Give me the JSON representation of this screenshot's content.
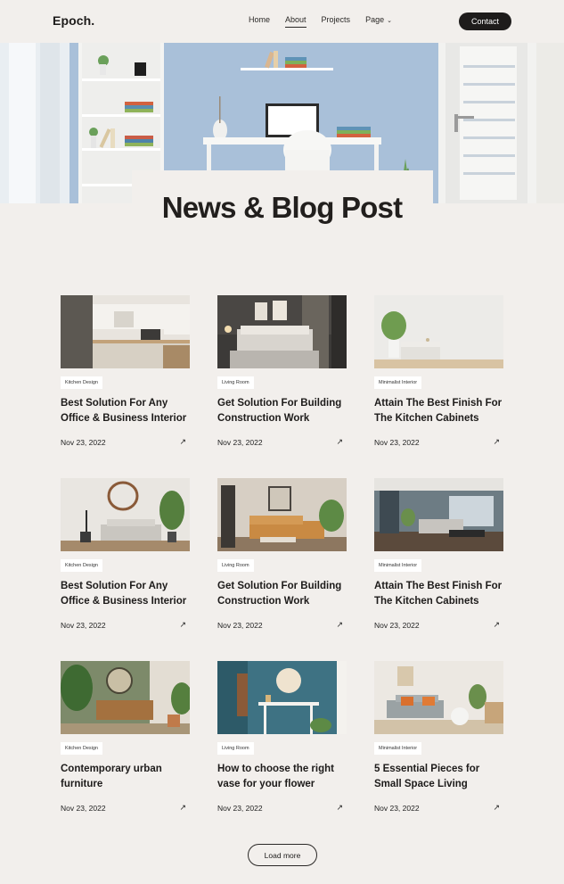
{
  "brand": {
    "logo": "Epoch."
  },
  "nav": {
    "items": [
      {
        "label": "Home"
      },
      {
        "label": "About",
        "active": true
      },
      {
        "label": "Projects"
      },
      {
        "label": "Page",
        "has_dropdown": true
      }
    ],
    "contact_label": "Contact"
  },
  "hero": {
    "title": "News & Blog Post"
  },
  "posts": [
    {
      "tag": "Kitchen Design",
      "title": "Best Solution For Any Office & Business Interior",
      "date": "Nov 23, 2022"
    },
    {
      "tag": "Living Room",
      "title": "Get Solution For Building Construction Work",
      "date": "Nov 23, 2022"
    },
    {
      "tag": "Minimalist Interior",
      "title": "Attain The Best Finish For The Kitchen Cabinets",
      "date": "Nov 23, 2022"
    },
    {
      "tag": "Kitchen Design",
      "title": "Best Solution For Any Office & Business Interior",
      "date": "Nov 23, 2022"
    },
    {
      "tag": "Living Room",
      "title": "Get Solution For Building Construction Work",
      "date": "Nov 23, 2022"
    },
    {
      "tag": "Minimalist Interior",
      "title": "Attain The Best Finish For The Kitchen Cabinets",
      "date": "Nov 23, 2022"
    },
    {
      "tag": "Kitchen Design",
      "title": "Contemporary urban furniture",
      "date": "Nov 23, 2022"
    },
    {
      "tag": "Living Room",
      "title": "How to choose the right vase for your flower",
      "date": "Nov 23, 2022"
    },
    {
      "tag": "Minimalist Interior",
      "title": "5 Essential Pieces for Small Space Living",
      "date": "Nov 23, 2022"
    }
  ],
  "load_more_label": "Load more",
  "icons": {
    "arrow": "arrow-up-right-icon",
    "chevron": "chevron-down-icon"
  },
  "colors": {
    "background": "#f2efec",
    "dark": "#1e1c1b",
    "hero_wall": "#a8bfd8"
  }
}
